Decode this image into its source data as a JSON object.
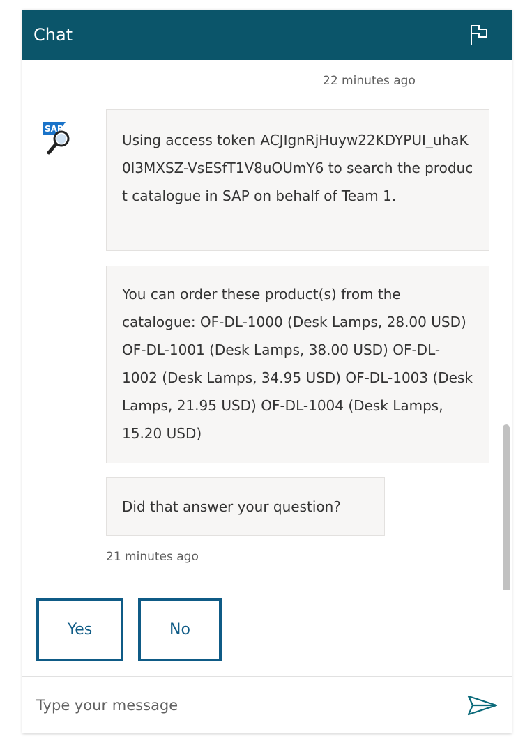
{
  "header": {
    "title": "Chat",
    "background": "#0b556a"
  },
  "transcript": {
    "timestamp_top": "22 minutes ago",
    "timestamp_bottom": "21 minutes ago",
    "avatar_text": "SAP",
    "messages": [
      {
        "text": "Using access token ACJIgnRjHuyw22KDYPUI_uhaK0l3MXSZ-VsESfT1V8uOUmY6 to search the product catalogue in SAP on behalf of Team 1."
      },
      {
        "text": "You can order these product(s) from the catalogue: OF-DL-1000 (Desk Lamps, 28.00 USD) OF-DL-1001 (Desk Lamps, 38.00 USD) OF-DL-1002 (Desk Lamps, 34.95 USD) OF-DL-1003 (Desk Lamps, 21.95 USD) OF-DL-1004 (Desk Lamps, 15.20 USD)"
      },
      {
        "text": "Did that answer your question?"
      }
    ]
  },
  "suggested_actions": {
    "yes_label": "Yes",
    "no_label": "No",
    "accent": "#0f5b86"
  },
  "composer": {
    "placeholder": "Type your message",
    "value": ""
  },
  "icons": {
    "flag": "flag-icon",
    "send": "send-icon",
    "bot_avatar": "sap-search-avatar-icon"
  }
}
